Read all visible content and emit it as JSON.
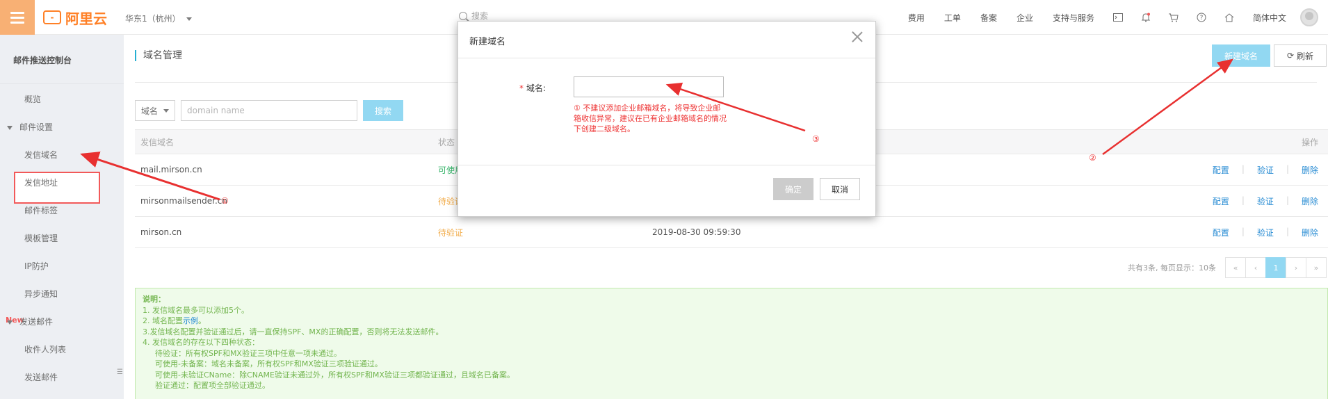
{
  "topbar": {
    "brand": "阿里云",
    "region": "华东1（杭州）",
    "search_placeholder": "搜索",
    "nav": [
      "费用",
      "工单",
      "备案",
      "企业",
      "支持与服务"
    ],
    "language": "简体中文",
    "icons": [
      "terminal-icon",
      "bell-icon",
      "cart-icon",
      "help-icon",
      "home-icon"
    ]
  },
  "sidebar": {
    "title": "邮件推送控制台",
    "items": [
      {
        "label": "概览",
        "type": "item"
      },
      {
        "label": "邮件设置",
        "type": "group"
      },
      {
        "label": "发信域名",
        "type": "item",
        "active": true
      },
      {
        "label": "发信地址",
        "type": "item"
      },
      {
        "label": "邮件标签",
        "type": "item"
      },
      {
        "label": "模板管理",
        "type": "item"
      },
      {
        "label": "IP防护",
        "type": "item"
      },
      {
        "label": "异步通知",
        "type": "item"
      },
      {
        "label": "发送邮件",
        "type": "group"
      },
      {
        "label": "收件人列表",
        "type": "item"
      },
      {
        "label": "发送邮件",
        "type": "item"
      }
    ],
    "new_badge": "New"
  },
  "main": {
    "page_title": "域名管理",
    "new_button": "新建域名",
    "refresh_button": "刷新",
    "filter": {
      "select_value": "域名",
      "placeholder": "domain name",
      "search_button": "搜索"
    },
    "table": {
      "headers": [
        "发信域名",
        "状态",
        "",
        "操作"
      ],
      "rows": [
        {
          "domain": "mail.mirson.cn",
          "status": "可使用",
          "status_type": "ok",
          "time": ""
        },
        {
          "domain": "mirsonmailsender.cn",
          "status": "待验证",
          "status_type": "pending",
          "time": ""
        },
        {
          "domain": "mirson.cn",
          "status": "待验证",
          "status_type": "pending",
          "time": "2019-08-30 09:59:30"
        }
      ],
      "ops": [
        "配置",
        "验证",
        "删除"
      ]
    },
    "pager": {
      "info": "共有3条, 每页显示：10条",
      "buttons": [
        "«",
        "‹",
        "1",
        "›",
        "»"
      ],
      "current": "1"
    },
    "notice": {
      "title": "说明：",
      "lines": [
        "1. 发信域名最多可以添加5个。",
        "2. 域名配置",
        "3.发信域名配置并验证通过后，请一直保持SPF、MX的正确配置，否则将无法发送邮件。",
        "4. 发信域名的存在以下四种状态：",
        "待验证：所有权SPF和MX验证三项中任意一项未通过。",
        "可使用-未备案：域名未备案，所有权SPF和MX验证三项验证通过。",
        "可使用-未验证CName：除CNAME验证未通过外，所有权SPF和MX验证三项都验证通过，且域名已备案。",
        "验证通过：配置项全部验证通过。"
      ],
      "example_link": "示例"
    }
  },
  "modal": {
    "title": "新建域名",
    "field_label": "域名:",
    "required_mark": "*",
    "input_value": "",
    "warning": "① 不建议添加企业邮箱域名，将导致企业邮箱收信异常，建议在已有企业邮箱域名的情况下创建二级域名。",
    "ok_button": "确定",
    "cancel_button": "取消"
  },
  "annotations": {
    "n1": "①",
    "n2": "②",
    "n3": "③",
    "color": "#e83030"
  }
}
